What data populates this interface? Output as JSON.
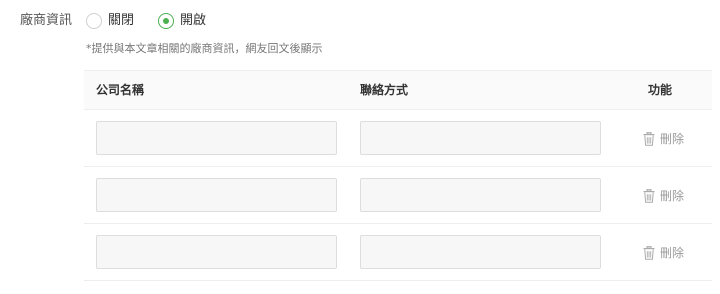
{
  "field": {
    "label": "廠商資訊",
    "options": [
      {
        "label": "關閉",
        "checked": false
      },
      {
        "label": "開啟",
        "checked": true
      }
    ],
    "accent_color": "#4caf50",
    "hint": "*提供與本文章相關的廠商資訊，網友回文後顯示"
  },
  "table": {
    "columns": {
      "company": "公司名稱",
      "contact": "聯絡方式",
      "action": "功能"
    },
    "rows": [
      {
        "company": "",
        "contact": "",
        "delete_label": "刪除",
        "icon": "trash-icon"
      },
      {
        "company": "",
        "contact": "",
        "delete_label": "刪除",
        "icon": "trash-icon"
      },
      {
        "company": "",
        "contact": "",
        "delete_label": "刪除",
        "icon": "trash-icon"
      }
    ]
  }
}
